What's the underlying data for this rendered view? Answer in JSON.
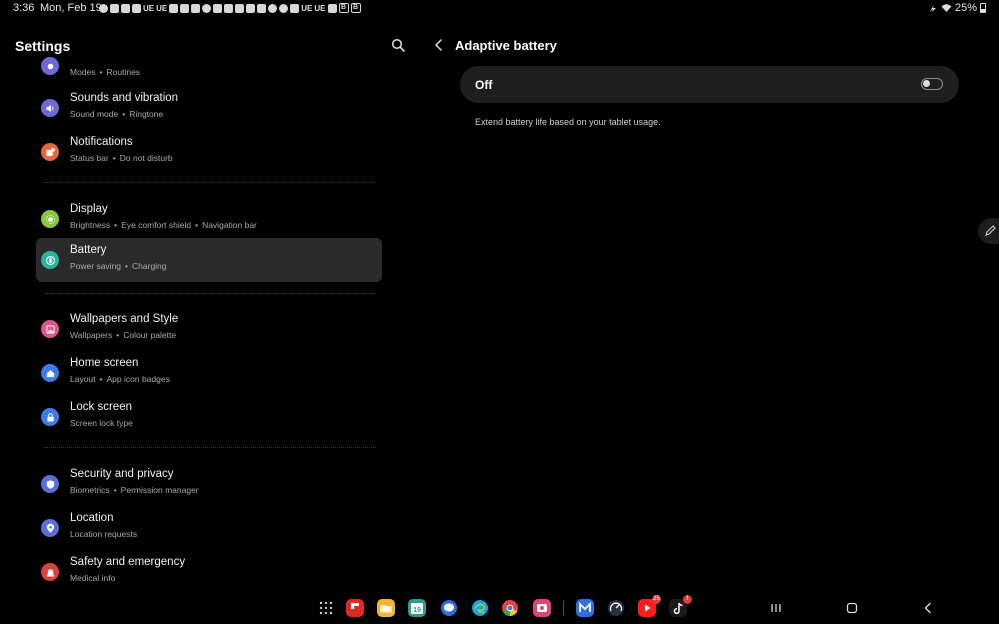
{
  "status_bar": {
    "time": "3:36",
    "date": "Mon, Feb 19",
    "battery_percent": "25%",
    "notification_icons": [
      "messenger-icon",
      "youtube-icon",
      "youtube-icon",
      "tiktok-icon",
      "ue-text",
      "ue-text",
      "youtube-icon",
      "youtube-icon",
      "youtube-icon",
      "cloud-icon",
      "youtube-icon",
      "youtube-icon",
      "youtube-icon",
      "youtube-icon",
      "youtube-icon",
      "threads-icon",
      "messenger-icon",
      "chat-icon",
      "ue-text",
      "ue-text",
      "gallery-icon",
      "b-icon",
      "b-icon"
    ]
  },
  "settings": {
    "title": "Settings",
    "items": [
      {
        "id": "modes",
        "title": "",
        "subtitle": [
          "Modes",
          "Routines"
        ],
        "icon": "modes-icon",
        "color": "#6f6bd6"
      },
      {
        "id": "sounds",
        "title": "Sounds and vibration",
        "subtitle": [
          "Sound mode",
          "Ringtone"
        ],
        "icon": "speaker-icon",
        "color": "#6f6bd6"
      },
      {
        "id": "notifications",
        "title": "Notifications",
        "subtitle": [
          "Status bar",
          "Do not disturb"
        ],
        "icon": "notification-icon",
        "color": "#e8673a"
      },
      {
        "id": "display",
        "title": "Display",
        "subtitle": [
          "Brightness",
          "Eye comfort shield",
          "Navigation bar"
        ],
        "icon": "sun-icon",
        "color": "#8cc43f"
      },
      {
        "id": "battery",
        "title": "Battery",
        "subtitle": [
          "Power saving",
          "Charging"
        ],
        "icon": "battery-icon",
        "color": "#2bb39b"
      },
      {
        "id": "wallpapers",
        "title": "Wallpapers and Style",
        "subtitle": [
          "Wallpapers",
          "Colour palette"
        ],
        "icon": "wallpaper-icon",
        "color": "#e0558a"
      },
      {
        "id": "home",
        "title": "Home screen",
        "subtitle": [
          "Layout",
          "App icon badges"
        ],
        "icon": "home-icon",
        "color": "#3d7ce4"
      },
      {
        "id": "lock",
        "title": "Lock screen",
        "subtitle": [
          "Screen lock type"
        ],
        "icon": "lock-icon",
        "color": "#3d7ce4"
      },
      {
        "id": "security",
        "title": "Security and privacy",
        "subtitle": [
          "Biometrics",
          "Permission manager"
        ],
        "icon": "shield-icon",
        "color": "#5a6fd8"
      },
      {
        "id": "location",
        "title": "Location",
        "subtitle": [
          "Location requests"
        ],
        "icon": "location-icon",
        "color": "#5a6fd8"
      },
      {
        "id": "safety",
        "title": "Safety and emergency",
        "subtitle": [
          "Medical info"
        ],
        "icon": "emergency-icon",
        "color": "#d9433c"
      }
    ]
  },
  "detail": {
    "title": "Adaptive battery",
    "toggle_label": "Off",
    "toggle_on": false,
    "description": "Extend battery life based on your tablet usage."
  },
  "taskbar": {
    "apps": [
      {
        "name": "apps-grid-icon",
        "color": "#cfcfcf"
      },
      {
        "name": "flipboard-icon",
        "color": "#e12828"
      },
      {
        "name": "my-files-icon",
        "color": "#f5b533"
      },
      {
        "name": "calendar-icon",
        "color": "#2c9e8d",
        "label": "19"
      },
      {
        "name": "messages-icon",
        "color": "#4a8cf0"
      },
      {
        "name": "edge-icon",
        "color": "#1ea1d9"
      },
      {
        "name": "chrome-icon",
        "color": "#e0e0e0"
      },
      {
        "name": "screen-recorder-icon",
        "color": "#e0457a"
      },
      {
        "name": "malwarebytes-icon",
        "color": "#2f6fe3"
      },
      {
        "name": "speedometer-icon",
        "color": "#2a2f3d"
      },
      {
        "name": "youtube-icon",
        "color": "#ff1e1e",
        "badge": "25"
      },
      {
        "name": "tiktok-icon",
        "color": "#111111",
        "badge": "1"
      }
    ]
  }
}
